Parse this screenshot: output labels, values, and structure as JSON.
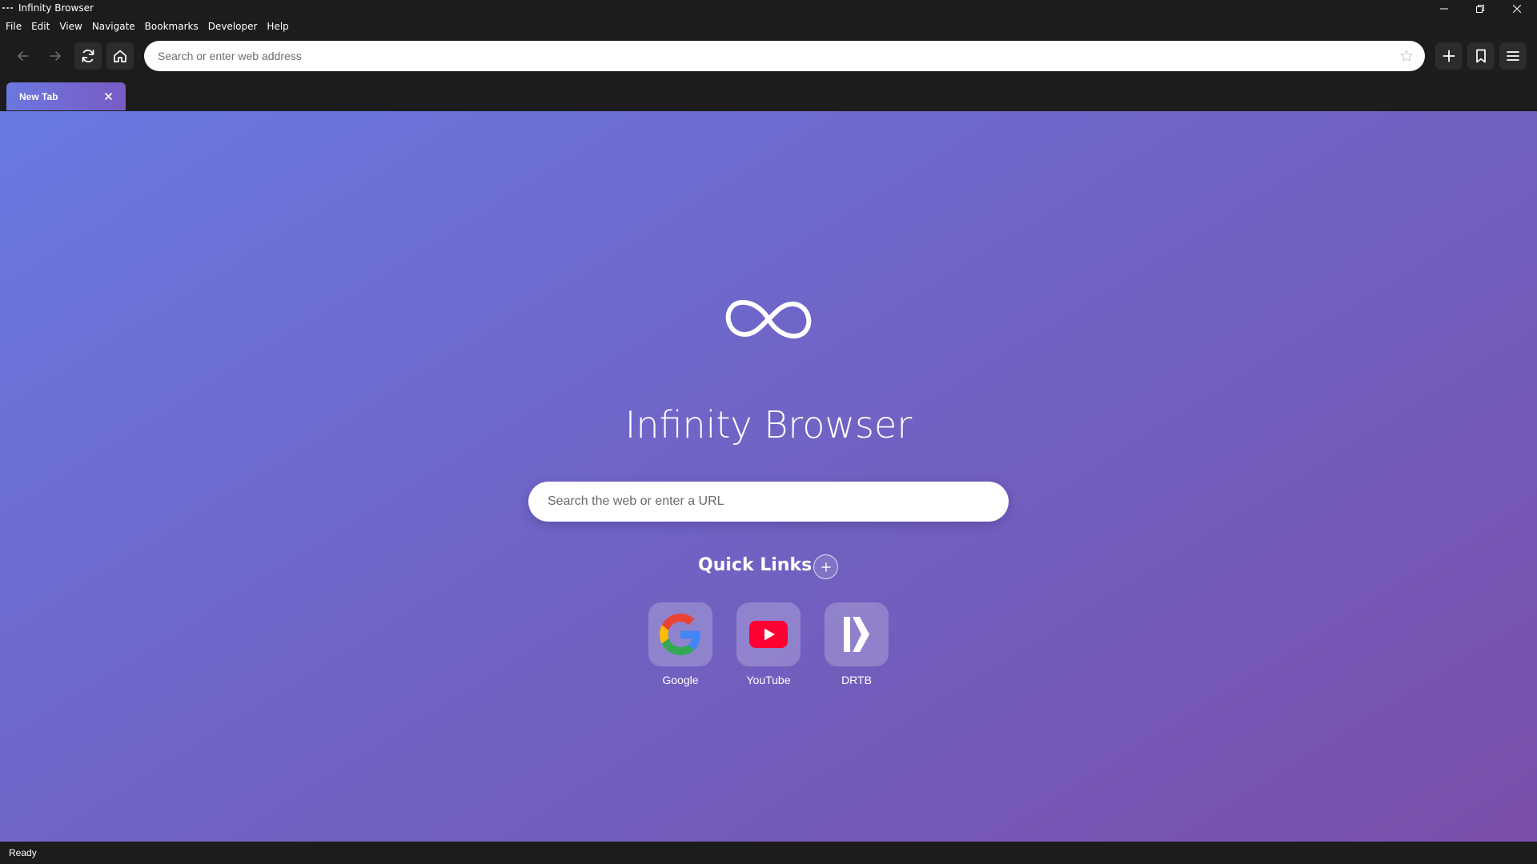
{
  "window": {
    "title": "Infinity Browser"
  },
  "menu": {
    "items": [
      "File",
      "Edit",
      "View",
      "Navigate",
      "Bookmarks",
      "Developer",
      "Help"
    ]
  },
  "toolbar": {
    "address_placeholder": "Search or enter web address"
  },
  "tabs": [
    {
      "label": "New Tab",
      "active": true
    }
  ],
  "newtab": {
    "title": "Infinity Browser",
    "search_placeholder": "Search the web or enter a URL",
    "quick_links_title": "Quick Links",
    "quick_links": [
      {
        "label": "Google",
        "icon": "google-icon"
      },
      {
        "label": "YouTube",
        "icon": "youtube-icon"
      },
      {
        "label": "DRTB",
        "icon": "drtb-icon"
      }
    ]
  },
  "status": {
    "text": "Ready"
  },
  "colors": {
    "chrome_bg": "#1c1c1c",
    "gradient_start": "#6a79e3",
    "gradient_end": "#7a4fab",
    "youtube_red": "#ff0033"
  }
}
